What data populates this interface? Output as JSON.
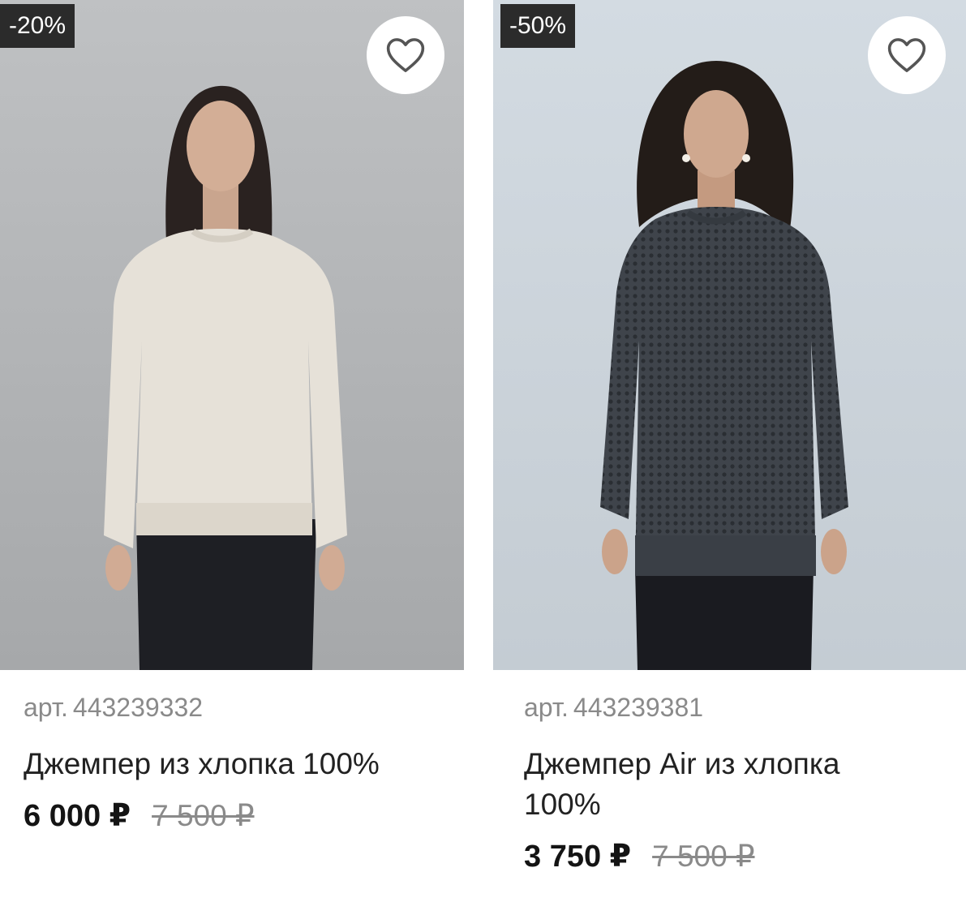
{
  "products": [
    {
      "discount": "-20%",
      "sku_prefix": "арт.",
      "sku": "443239332",
      "name": "Джемпер из хлопка 100%",
      "price_now": "6 000 ₽",
      "price_old": "7 500 ₽",
      "favorite_icon": "heart-outline-icon"
    },
    {
      "discount": "-50%",
      "sku_prefix": "арт.",
      "sku": "443239381",
      "name": "Джемпер Air из хлопка 100%",
      "price_now": "3 750 ₽",
      "price_old": "7 500 ₽",
      "favorite_icon": "heart-outline-icon"
    }
  ],
  "colors": {
    "badge_bg": "#2b2b2b",
    "price_old": "#8a8a8a",
    "sku": "#8a8a8a"
  }
}
